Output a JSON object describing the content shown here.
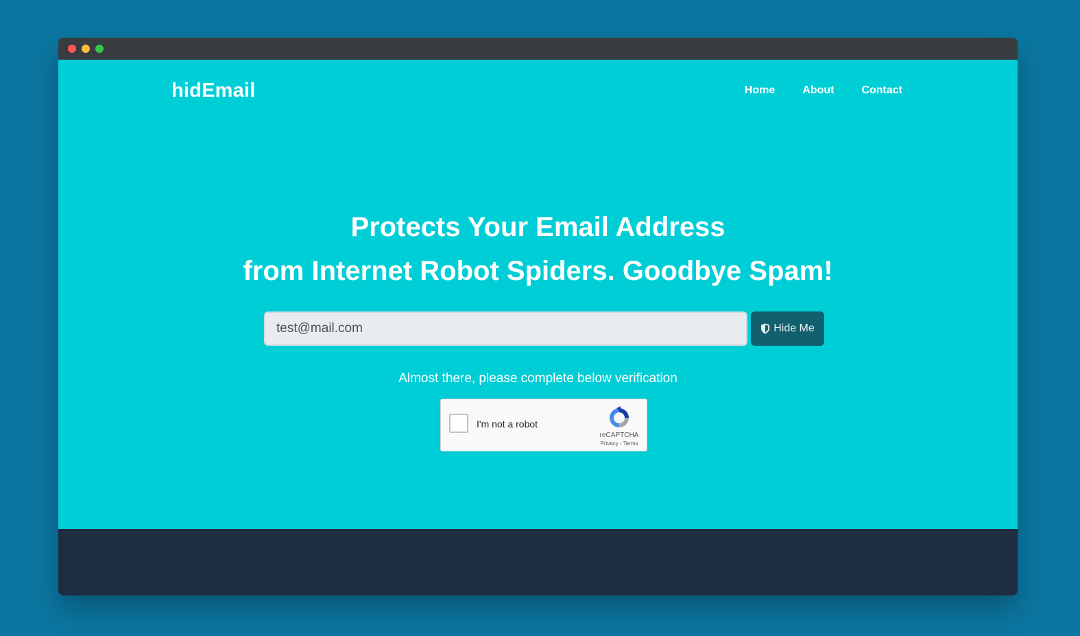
{
  "brand": "hidEmail",
  "nav": {
    "home": "Home",
    "about": "About",
    "contact": "Contact"
  },
  "hero": {
    "line1": "Protects Your Email Address",
    "line2": "from Internet Robot Spiders. Goodbye Spam!"
  },
  "form": {
    "email_value": "test@mail.com",
    "button_label": "Hide Me",
    "button_icon": "shield-icon"
  },
  "verification": {
    "prompt": "Almost there, please complete below verification",
    "checkbox_label": "I'm not a robot",
    "brand": "reCAPTCHA",
    "privacy": "Privacy",
    "separator": " - ",
    "terms": "Terms"
  },
  "colors": {
    "hero_bg": "#00ced6",
    "button_bg": "#125f6e",
    "footer_bg": "#1f2d42",
    "page_bg": "#0b76a0"
  }
}
